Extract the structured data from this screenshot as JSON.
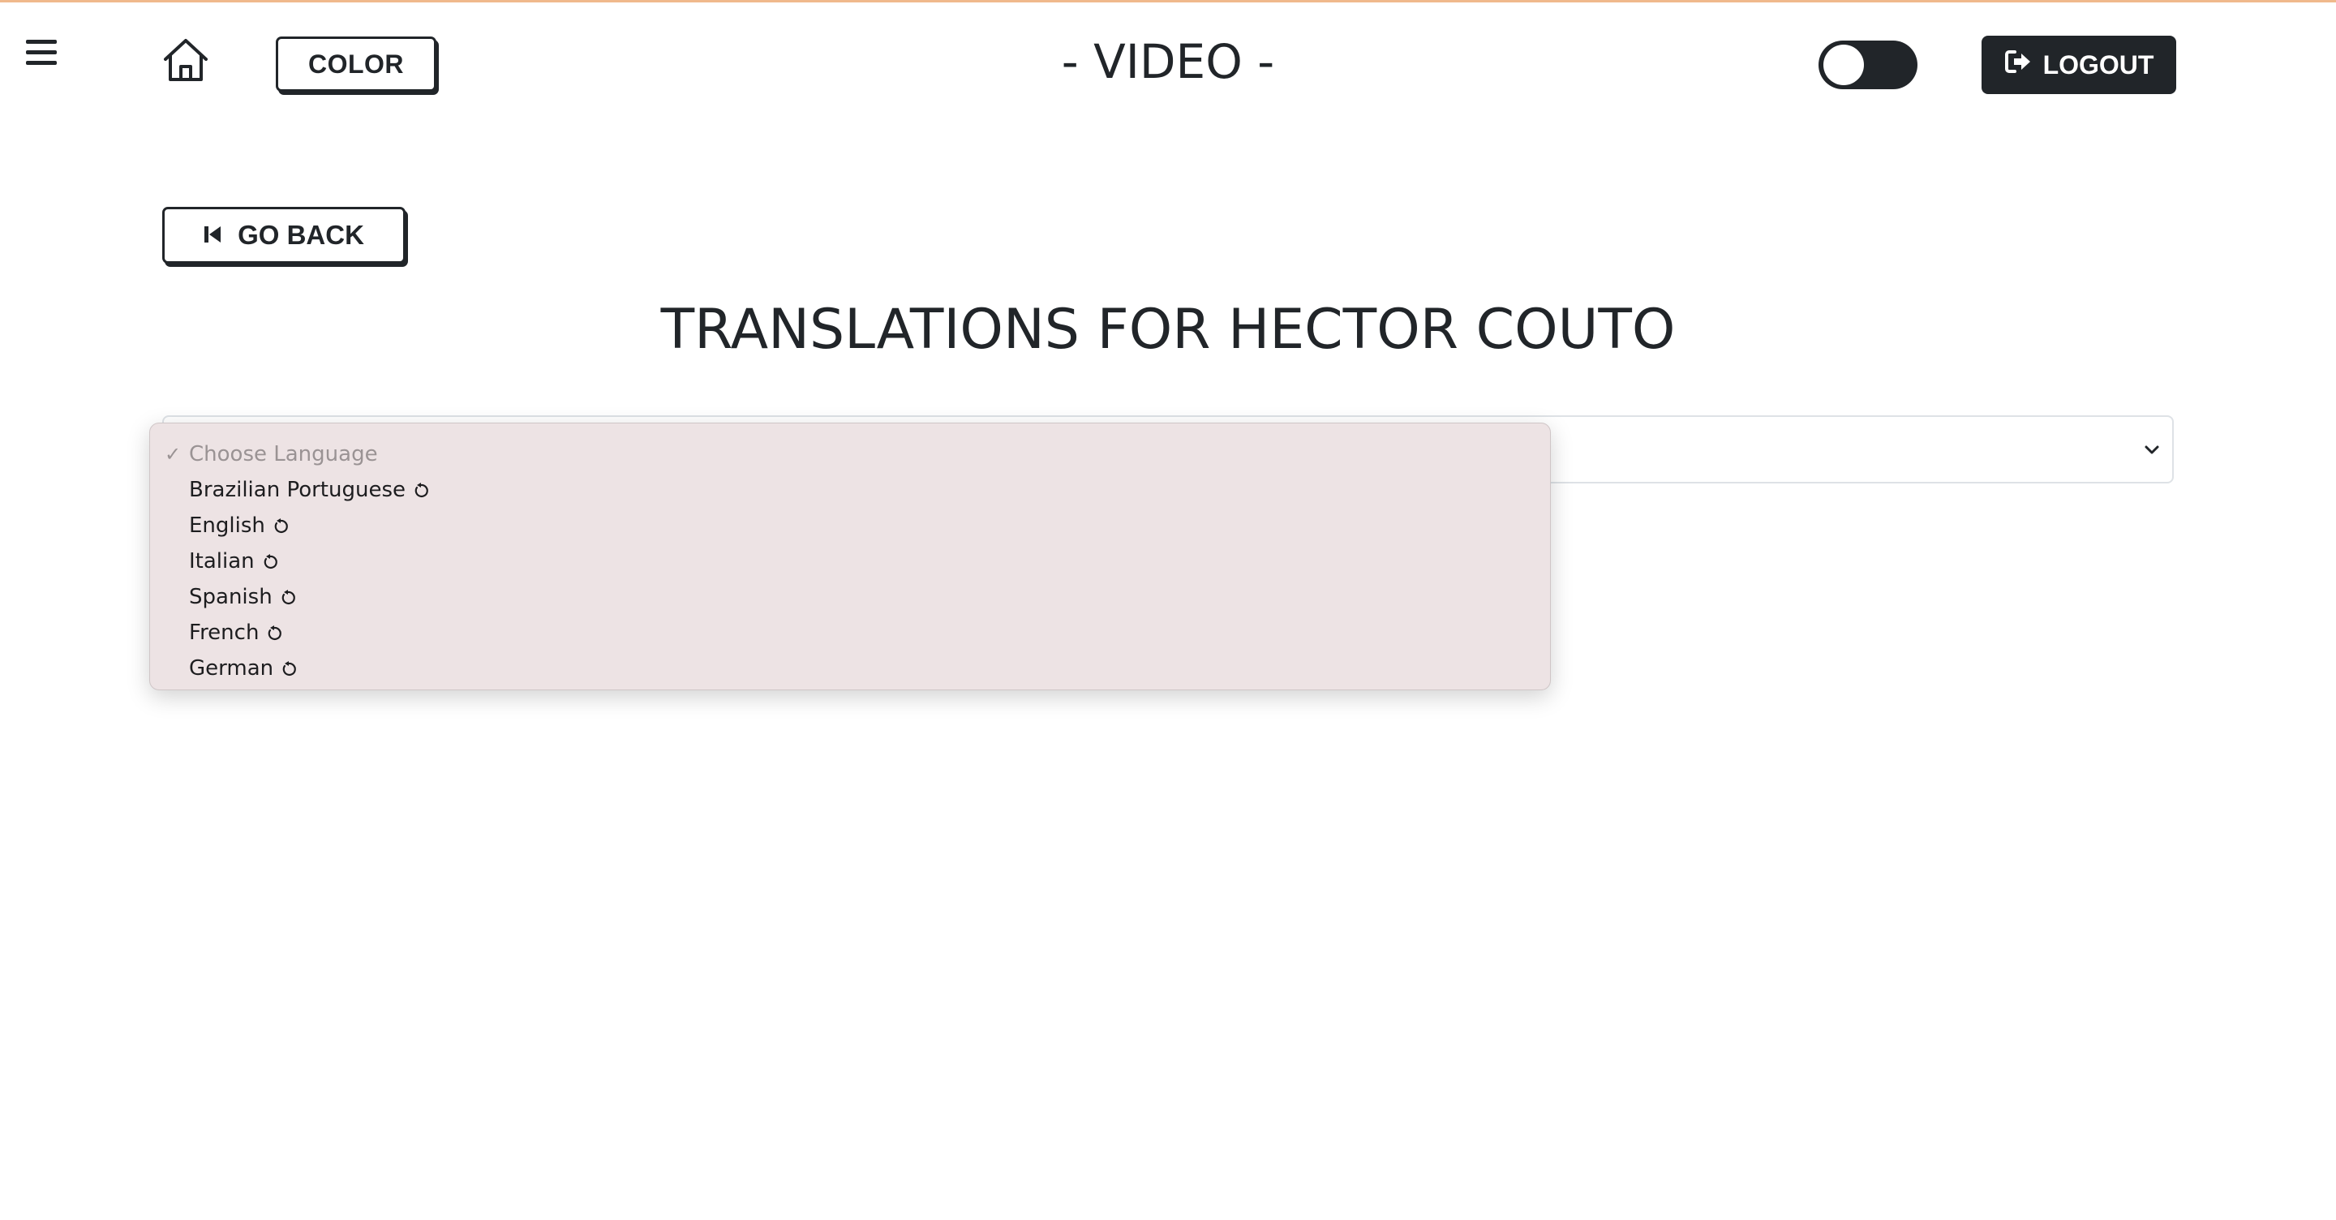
{
  "header": {
    "menu_icon": "hamburger-menu-icon",
    "home_icon": "home-icon",
    "color_button_label": "COLOR",
    "title": "- VIDEO -",
    "theme_toggle": {
      "state": "dark",
      "icon": "toggle-switch"
    },
    "logout": {
      "label": "LOGOUT",
      "icon": "logout-icon"
    }
  },
  "main": {
    "go_back": {
      "label": "GO BACK",
      "icon": "skip-back-icon"
    },
    "heading": "TRANSLATIONS FOR HECTOR COUTO",
    "language_select": {
      "placeholder": "Choose Language",
      "selected": "Choose Language",
      "expanded": true,
      "options": [
        {
          "label": "Choose Language",
          "checked": true,
          "placeholder": true,
          "icon": "checkmark-icon"
        },
        {
          "label": "Brazilian Portuguese",
          "icon": "refresh-icon"
        },
        {
          "label": "English",
          "icon": "refresh-icon"
        },
        {
          "label": "Italian",
          "icon": "refresh-icon"
        },
        {
          "label": "Spanish",
          "icon": "refresh-icon"
        },
        {
          "label": "French",
          "icon": "refresh-icon"
        },
        {
          "label": "German",
          "icon": "refresh-icon"
        }
      ]
    }
  },
  "colors": {
    "accent_dark": "#212529",
    "top_rule": "#f0b98c",
    "dropdown_bg": "#ede3e4"
  }
}
